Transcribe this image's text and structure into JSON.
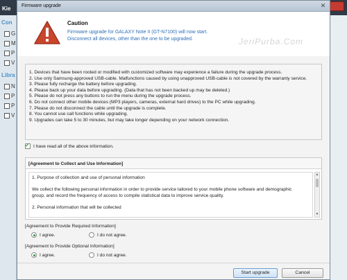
{
  "background_app": {
    "title": "Kie",
    "section_1": "Con",
    "section_2": "Libra",
    "items": [
      "G",
      "M",
      "P",
      "V",
      "N",
      "P",
      "P",
      "V"
    ]
  },
  "dialog": {
    "title": "Firmware upgrade",
    "caution_title": "Caution",
    "caution_line_1": "Firmware upgrade for GALAXY Note II  (GT-N7100) will now start.",
    "caution_line_2": "Disconnect all devices, other than the one to be upgraded.",
    "watermark": "JeriPurba.Com",
    "notices": [
      "1. Devices that have been rooted or modified with customized software may experience a failure during the upgrade process.",
      "2. Use only Samsung-approved USB-cable. Malfunctions caused by using unapproved USB-cable is not covered by the warranty service.",
      "3. Please fully recharge the battery before upgrading.",
      "4. Please back up your data before upgrading. (Data that has not been backed up may be deleted.)",
      "5. Please do not press any buttons to run the menu during the upgrade process.",
      "6. Do not connect other mobile devices (MP3 players, cameras, external hard drives) to the PC while upgrading.",
      "7. Please do not disconnect the cable until the upgrade is complete.",
      "8. You cannot use call functions while upgrading.",
      "9. Upgrades can take 5 to 30 minutes, but may take longer depending on your network connection."
    ],
    "read_all_label": "I have read all of the above information.",
    "read_all_checked": true,
    "agreement_header": "[Agreement to Collect and Use Information]",
    "agreement_text": [
      "1. Purpose of collection and use of personal information",
      "",
      "We collect the following personal information in order to provide service tailored to your mobile phone software and demographic",
      "group, and record the frequency of access to compile statistical data to improve service quality.",
      "",
      "2. Personal information that will be collected"
    ],
    "required_label": "[Agreement to Provide Required Information]",
    "optional_label": "[Agreement to Provide Optional Information]",
    "agree_label": "I agree.",
    "disagree_label": "I do not agree.",
    "required_selected": "agree",
    "optional_selected": "agree",
    "start_button": "Start upgrade",
    "cancel_button": "Cancel",
    "colors": {
      "accent_blue": "#2d6eb5",
      "warning_red": "#c9452c",
      "check_green": "#2d9a3a"
    }
  }
}
